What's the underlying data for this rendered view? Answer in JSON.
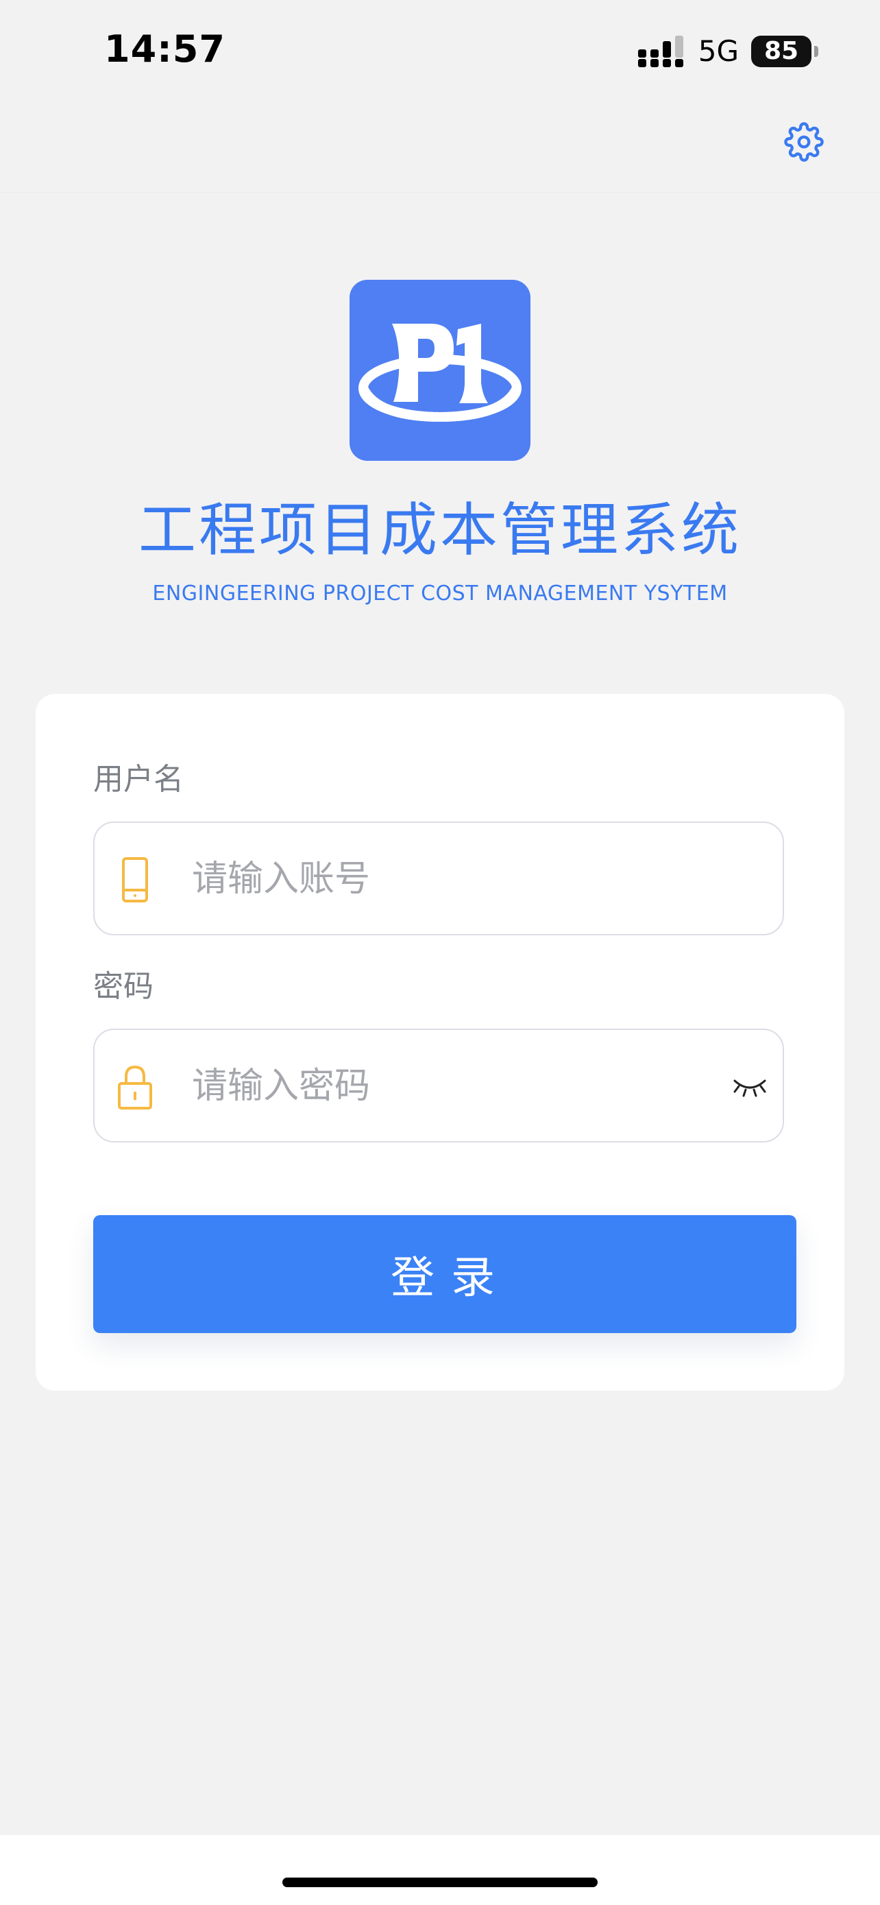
{
  "status_bar": {
    "time": "14:57",
    "network": "5G",
    "battery": "85"
  },
  "app": {
    "title": "工程项目成本管理系统",
    "subtitle": "ENGINGEERING PROJECT COST MANAGEMENT YSYTEM",
    "accent_color": "#3a7af0",
    "logo_color": "#4f7ff2"
  },
  "form": {
    "username_label": "用户名",
    "username_placeholder": "请输入账号",
    "username_value": "",
    "password_label": "密码",
    "password_placeholder": "请输入密码",
    "password_value": "",
    "login_label": "登录",
    "button_color": "#3b82f6",
    "icon_color": "#f5b942"
  },
  "icons": {
    "settings": "gear-icon",
    "username": "phone-icon",
    "password": "lock-icon",
    "toggle_visibility": "eye-closed-icon",
    "logo": "p1-logo-icon"
  }
}
